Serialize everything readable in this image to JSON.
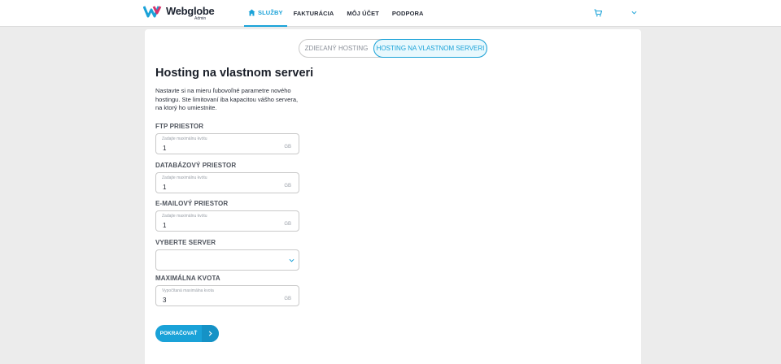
{
  "header": {
    "logo_text": "Webglobe",
    "logo_sub": "Admin",
    "nav": [
      {
        "label": "SLUŽBY",
        "active": true
      },
      {
        "label": "FAKTURÁCIA",
        "active": false
      },
      {
        "label": "MÔJ ÚČET",
        "active": false
      },
      {
        "label": "PODPORA",
        "active": false
      }
    ],
    "icons": {
      "cart": "cart-icon",
      "account": "chevron-down-icon"
    }
  },
  "tabs": {
    "shared": "ZDIEĽANÝ HOSTING",
    "own": "HOSTING NA VLASTNOM SERVERI",
    "selected": "own"
  },
  "main": {
    "title": "Hosting na vlastnom serveri",
    "description": "Nastavte si na mieru ľubovoľné parametre nového hostingu. Ste limitovaní iba kapacitou vášho servera, na ktorý ho umiestnite."
  },
  "fields": {
    "ftp": {
      "label": "FTP PRIESTOR",
      "hint": "Zadajte maximálnu kvótu",
      "value": "1",
      "unit": "GB"
    },
    "db": {
      "label": "DATABÁZOVÝ PRIESTOR",
      "hint": "Zadajte maximálnu kvótu",
      "value": "1",
      "unit": "GB"
    },
    "mail": {
      "label": "E-MAILOVÝ PRIESTOR",
      "hint": "Zadajte maximálnu kvótu",
      "value": "1",
      "unit": "GB"
    },
    "server": {
      "label": "VYBERTE SERVER",
      "value": ""
    },
    "quota": {
      "label": "MAXIMÁLNA KVOTA",
      "hint": "Vypočítaná maximálna kvota",
      "value": "3",
      "unit": "GB"
    }
  },
  "actions": {
    "continue": "POKRAČOVAŤ"
  },
  "colors": {
    "accent": "#1aa2d8",
    "background": "#ececec"
  }
}
